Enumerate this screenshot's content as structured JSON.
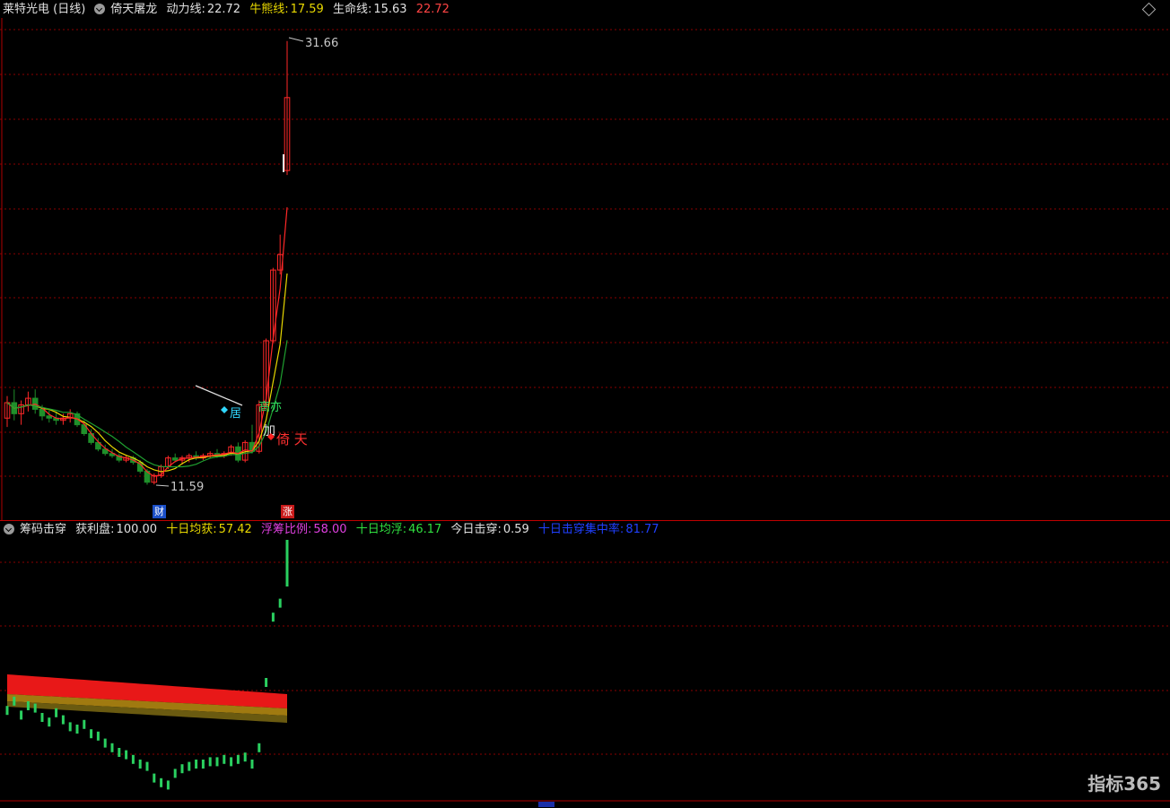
{
  "main_header": {
    "stock": "莱特光电 (日线)",
    "indicator": "倚天屠龙",
    "l1_label": "动力线:",
    "l1_value": "22.72",
    "l2_label": "牛熊线:",
    "l2_value": "17.59",
    "l3_label": "生命线:",
    "l3_value": "15.63",
    "l4_value": "22.72"
  },
  "price_labels": {
    "high": "31.66",
    "low": "11.59"
  },
  "signals": {
    "buy_label": "倚 天",
    "mid_label": "加",
    "annot1": "居",
    "annot2": "高亦"
  },
  "tags": {
    "cai": "财",
    "zhang": "涨"
  },
  "ind_header": {
    "name": "筹码击穿",
    "i1_label": "获利盘:",
    "i1_value": "100.00",
    "i2_label": "十日均获:",
    "i2_value": "57.42",
    "i3_label": "浮筹比例:",
    "i3_value": "58.00",
    "i4_label": "十日均浮:",
    "i4_value": "46.17",
    "i5_label": "今日击穿:",
    "i5_value": "0.59",
    "i6_label": "十日击穿集中率:",
    "i6_value": "81.77"
  },
  "logo": "指标365",
  "colors": {
    "up": "#ff2828",
    "down": "#1f8f2a",
    "yellow": "#e8d800",
    "grid": "#8a0000",
    "divider": "#b00000"
  },
  "chart_data": {
    "type": "candlestick",
    "candles": [
      [
        14.6,
        15.6,
        14.2,
        15.3
      ],
      [
        15.3,
        15.9,
        14.5,
        14.8
      ],
      [
        14.8,
        15.4,
        14.3,
        15.2
      ],
      [
        15.2,
        15.8,
        14.9,
        15.5
      ],
      [
        15.5,
        15.9,
        14.8,
        15.0
      ],
      [
        15.0,
        15.2,
        14.5,
        14.7
      ],
      [
        14.7,
        15.0,
        14.4,
        14.6
      ],
      [
        14.6,
        14.9,
        14.3,
        14.5
      ],
      [
        14.5,
        14.8,
        14.3,
        14.6
      ],
      [
        14.6,
        15.0,
        14.4,
        14.8
      ],
      [
        14.8,
        14.9,
        14.2,
        14.3
      ],
      [
        14.3,
        14.5,
        13.8,
        13.9
      ],
      [
        13.9,
        14.1,
        13.4,
        13.5
      ],
      [
        13.5,
        13.7,
        13.1,
        13.2
      ],
      [
        13.2,
        13.4,
        12.9,
        13.0
      ],
      [
        13.0,
        13.2,
        12.8,
        12.9
      ],
      [
        12.9,
        13.0,
        12.6,
        12.7
      ],
      [
        12.7,
        12.9,
        12.6,
        12.8
      ],
      [
        12.8,
        12.9,
        12.5,
        12.6
      ],
      [
        12.6,
        12.7,
        12.1,
        12.2
      ],
      [
        12.2,
        12.3,
        11.59,
        11.7
      ],
      [
        11.7,
        12.1,
        11.6,
        12.0
      ],
      [
        12.0,
        12.5,
        11.9,
        12.4
      ],
      [
        12.4,
        12.9,
        12.3,
        12.8
      ],
      [
        12.8,
        13.0,
        12.6,
        12.7
      ],
      [
        12.7,
        12.9,
        12.5,
        12.8
      ],
      [
        12.8,
        13.0,
        12.6,
        12.9
      ],
      [
        12.9,
        13.1,
        12.7,
        12.8
      ],
      [
        12.8,
        13.0,
        12.7,
        12.9
      ],
      [
        12.9,
        13.1,
        12.8,
        13.0
      ],
      [
        13.0,
        13.2,
        12.8,
        12.9
      ],
      [
        12.9,
        13.1,
        12.8,
        13.0
      ],
      [
        13.0,
        13.4,
        12.9,
        13.3
      ],
      [
        13.3,
        13.5,
        12.6,
        12.7
      ],
      [
        12.7,
        13.6,
        12.6,
        13.5
      ],
      [
        13.5,
        14.3,
        13.0,
        13.1
      ],
      [
        13.1,
        15.4,
        13.0,
        15.2
      ],
      [
        15.2,
        18.2,
        15.0,
        18.1
      ],
      [
        18.1,
        21.4,
        18.0,
        21.3
      ],
      [
        21.3,
        22.9,
        21.1,
        22.0
      ],
      [
        25.8,
        31.66,
        25.6,
        29.1
      ]
    ],
    "indicator_lines": [
      "动力线",
      "牛熊线",
      "生命线"
    ],
    "profit_bars": [
      38,
      42,
      36,
      40,
      39,
      35,
      33,
      37,
      34,
      31,
      30,
      32,
      28,
      27,
      24,
      22,
      20,
      19,
      17,
      15,
      14,
      9,
      7,
      6,
      11,
      13,
      14,
      15,
      15,
      16,
      16,
      17,
      16,
      17,
      18,
      15,
      22,
      50,
      78,
      84,
      100
    ]
  }
}
